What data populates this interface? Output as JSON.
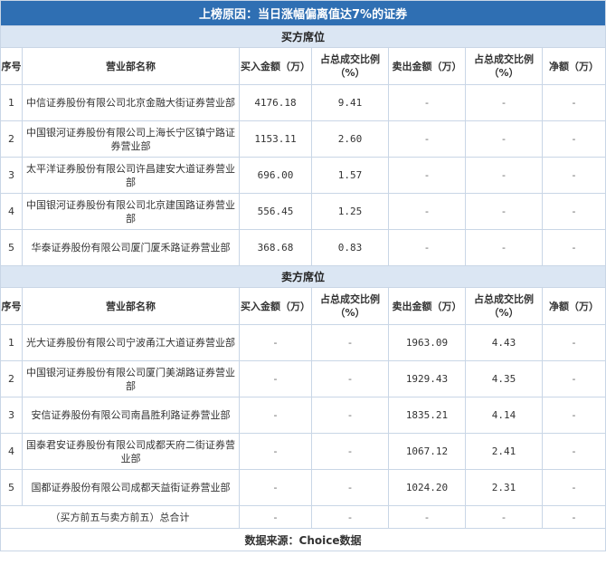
{
  "title": "上榜原因：当日涨幅偏离值达7%的证券",
  "buy_section": "买方席位",
  "sell_section": "卖方席位",
  "headers": {
    "seq": "序号",
    "name": "营业部名称",
    "buy": "买入金额（万）",
    "buy_pct": "占总成交比例（%）",
    "sell": "卖出金额（万）",
    "sell_pct": "占总成交比例（%）",
    "net": "净额（万）"
  },
  "buy_rows": [
    {
      "seq": "1",
      "name": "中信证券股份有限公司北京金融大街证券营业部",
      "buy": "4176.18",
      "buy_pct": "9.41",
      "sell": "-",
      "sell_pct": "-",
      "net": "-"
    },
    {
      "seq": "2",
      "name": "中国银河证券股份有限公司上海长宁区镇宁路证券营业部",
      "buy": "1153.11",
      "buy_pct": "2.60",
      "sell": "-",
      "sell_pct": "-",
      "net": "-"
    },
    {
      "seq": "3",
      "name": "太平洋证券股份有限公司许昌建安大道证券营业部",
      "buy": "696.00",
      "buy_pct": "1.57",
      "sell": "-",
      "sell_pct": "-",
      "net": "-"
    },
    {
      "seq": "4",
      "name": "中国银河证券股份有限公司北京建国路证券营业部",
      "buy": "556.45",
      "buy_pct": "1.25",
      "sell": "-",
      "sell_pct": "-",
      "net": "-"
    },
    {
      "seq": "5",
      "name": "华泰证券股份有限公司厦门厦禾路证券营业部",
      "buy": "368.68",
      "buy_pct": "0.83",
      "sell": "-",
      "sell_pct": "-",
      "net": "-"
    }
  ],
  "sell_rows": [
    {
      "seq": "1",
      "name": "光大证券股份有限公司宁波甬江大道证券营业部",
      "buy": "-",
      "buy_pct": "-",
      "sell": "1963.09",
      "sell_pct": "4.43",
      "net": "-"
    },
    {
      "seq": "2",
      "name": "中国银河证券股份有限公司厦门美湖路证券营业部",
      "buy": "-",
      "buy_pct": "-",
      "sell": "1929.43",
      "sell_pct": "4.35",
      "net": "-"
    },
    {
      "seq": "3",
      "name": "安信证券股份有限公司南昌胜利路证券营业部",
      "buy": "-",
      "buy_pct": "-",
      "sell": "1835.21",
      "sell_pct": "4.14",
      "net": "-"
    },
    {
      "seq": "4",
      "name": "国泰君安证券股份有限公司成都天府二街证券营业部",
      "buy": "-",
      "buy_pct": "-",
      "sell": "1067.12",
      "sell_pct": "2.41",
      "net": "-"
    },
    {
      "seq": "5",
      "name": "国都证券股份有限公司成都天益街证券营业部",
      "buy": "-",
      "buy_pct": "-",
      "sell": "1024.20",
      "sell_pct": "2.31",
      "net": "-"
    }
  ],
  "total_row": {
    "label": "（买方前五与卖方前五）总合计",
    "buy": "-",
    "buy_pct": "-",
    "sell": "-",
    "sell_pct": "-",
    "net": "-"
  },
  "footer": "数据来源：Choice数据"
}
